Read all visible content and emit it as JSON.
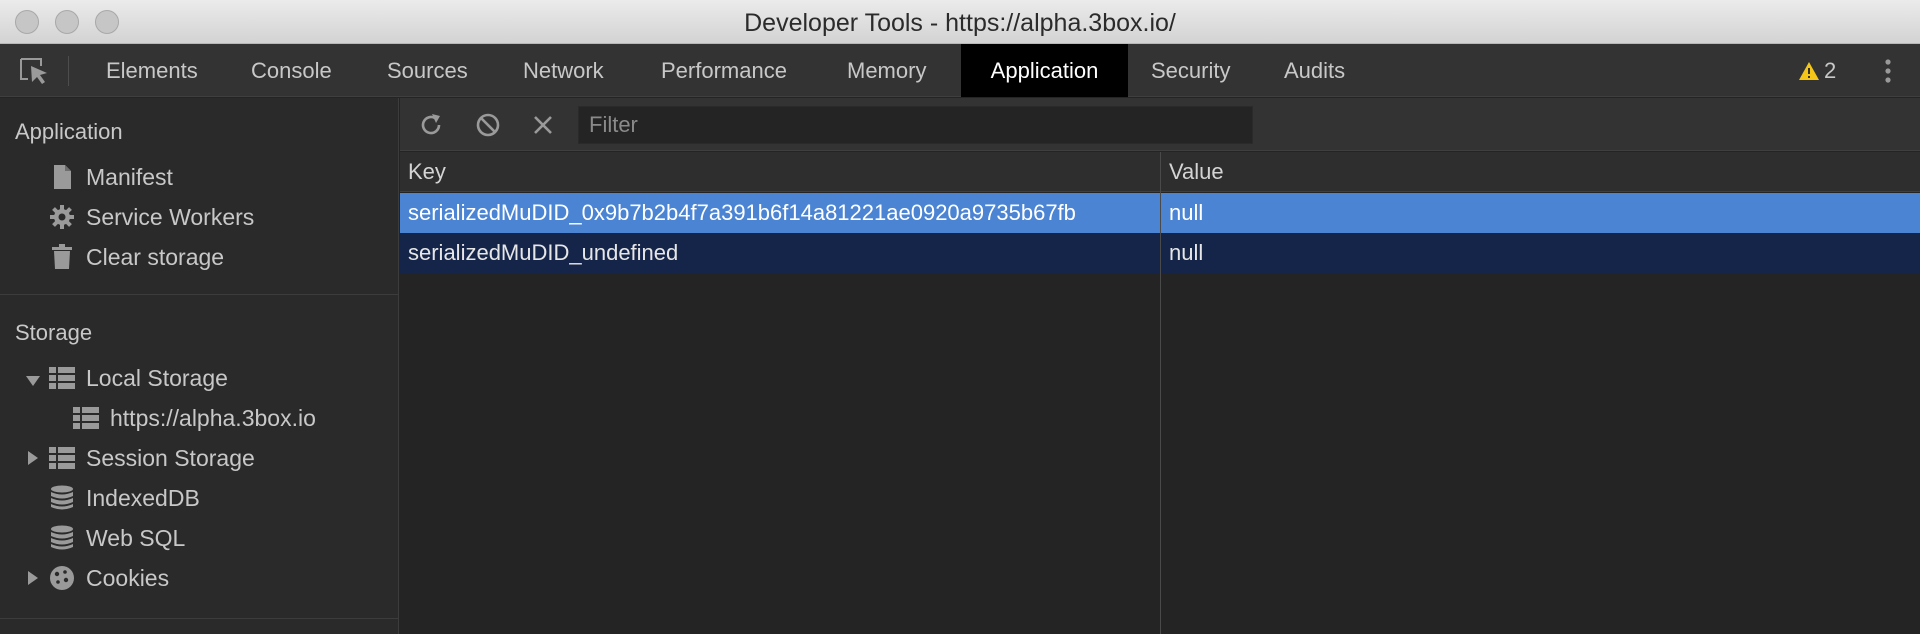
{
  "window": {
    "title": "Developer Tools - https://alpha.3box.io/"
  },
  "tabs": [
    {
      "label": "Elements",
      "active": false
    },
    {
      "label": "Console",
      "active": false
    },
    {
      "label": "Sources",
      "active": false
    },
    {
      "label": "Network",
      "active": false
    },
    {
      "label": "Performance",
      "active": false
    },
    {
      "label": "Memory",
      "active": false
    },
    {
      "label": "Application",
      "active": true
    },
    {
      "label": "Security",
      "active": false
    },
    {
      "label": "Audits",
      "active": false
    }
  ],
  "warnings": {
    "count": "2"
  },
  "sidebar": {
    "application_title": "Application",
    "application_items": [
      {
        "label": "Manifest",
        "icon": "document-icon"
      },
      {
        "label": "Service Workers",
        "icon": "gear-icon"
      },
      {
        "label": "Clear storage",
        "icon": "trash-icon"
      }
    ],
    "storage_title": "Storage",
    "storage_items": [
      {
        "label": "Local Storage",
        "icon": "table-icon",
        "expand": "expanded"
      },
      {
        "label": "https://alpha.3box.io",
        "icon": "table-icon",
        "expand": "none",
        "child": true
      },
      {
        "label": "Session Storage",
        "icon": "table-icon",
        "expand": "collapsed"
      },
      {
        "label": "IndexedDB",
        "icon": "database-icon",
        "expand": "none"
      },
      {
        "label": "Web SQL",
        "icon": "database-icon",
        "expand": "none"
      },
      {
        "label": "Cookies",
        "icon": "cookie-icon",
        "expand": "collapsed"
      }
    ]
  },
  "toolbar": {
    "filter_placeholder": "Filter"
  },
  "table": {
    "columns": [
      "Key",
      "Value"
    ],
    "rows": [
      {
        "key": "serializedMuDID_0x9b7b2b4f7a391b6f14a81221ae0920a9735b67fb",
        "value": "null",
        "selected": true
      },
      {
        "key": "serializedMuDID_undefined",
        "value": "null",
        "selected": false
      }
    ]
  },
  "colors": {
    "selected_row": "#4a84d3",
    "secondary_row": "#15254a",
    "active_tab": "#000000",
    "warning": "#f5c518"
  }
}
